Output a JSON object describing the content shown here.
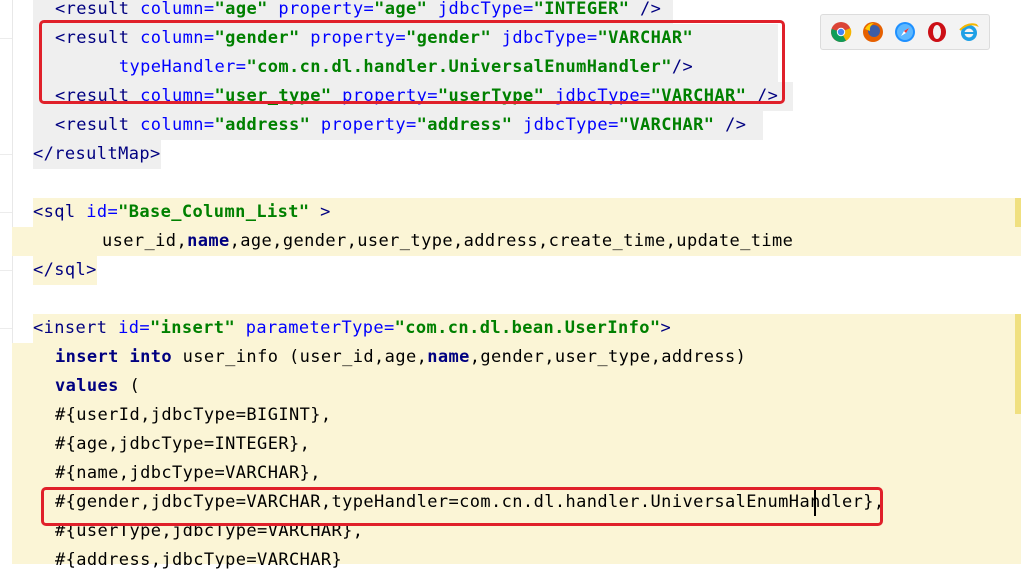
{
  "editor": {
    "lines": [
      {
        "id": "l1",
        "segments": [
          [
            "tag",
            "<result "
          ],
          [
            "attr",
            "column="
          ],
          [
            "str",
            "\"age\""
          ],
          [
            "plain",
            " "
          ],
          [
            "attr",
            "property="
          ],
          [
            "str",
            "\"age\""
          ],
          [
            "plain",
            " "
          ],
          [
            "attr",
            "jdbcType="
          ],
          [
            "str",
            "\"INTEGER\""
          ],
          [
            "plain",
            " "
          ],
          [
            "tag",
            "/>"
          ]
        ]
      },
      {
        "id": "l2",
        "segments": [
          [
            "tag",
            "<result "
          ],
          [
            "attr",
            "column="
          ],
          [
            "str",
            "\"gender\""
          ],
          [
            "plain",
            " "
          ],
          [
            "attr",
            "property="
          ],
          [
            "str",
            "\"gender\""
          ],
          [
            "plain",
            " "
          ],
          [
            "attr",
            "jdbcType="
          ],
          [
            "str",
            "\"VARCHAR\""
          ]
        ]
      },
      {
        "id": "l3",
        "segments": [
          [
            "plain",
            "      "
          ],
          [
            "attr",
            "typeHandler="
          ],
          [
            "str",
            "\"com.cn.dl.handler.UniversalEnumHandler\""
          ],
          [
            "tag",
            "/>"
          ]
        ]
      },
      {
        "id": "l4",
        "segments": [
          [
            "tag",
            "<result "
          ],
          [
            "attr",
            "column="
          ],
          [
            "str",
            "\"user_type\""
          ],
          [
            "plain",
            " "
          ],
          [
            "attr",
            "property="
          ],
          [
            "str",
            "\"userType\""
          ],
          [
            "plain",
            " "
          ],
          [
            "attr",
            "jdbcType="
          ],
          [
            "str",
            "\"VARCHAR\""
          ],
          [
            "plain",
            " "
          ],
          [
            "tag",
            "/>"
          ]
        ]
      },
      {
        "id": "l5",
        "segments": [
          [
            "tag",
            "<result "
          ],
          [
            "attr",
            "column="
          ],
          [
            "str",
            "\"address\""
          ],
          [
            "plain",
            " "
          ],
          [
            "attr",
            "property="
          ],
          [
            "str",
            "\"address\""
          ],
          [
            "plain",
            " "
          ],
          [
            "attr",
            "jdbcType="
          ],
          [
            "str",
            "\"VARCHAR\""
          ],
          [
            "plain",
            " "
          ],
          [
            "tag",
            "/>"
          ]
        ]
      },
      {
        "id": "l6",
        "segments": [
          [
            "tag",
            "</resultMap>"
          ]
        ]
      },
      {
        "id": "l7",
        "segments": []
      },
      {
        "id": "l8",
        "segments": [
          [
            "tag",
            "<sql "
          ],
          [
            "attr",
            "id="
          ],
          [
            "str",
            "\"Base_Column_List\""
          ],
          [
            "plain",
            " "
          ],
          [
            "tag",
            ">"
          ]
        ]
      },
      {
        "id": "l9",
        "segments": [
          [
            "plain",
            "user_id,"
          ],
          [
            "bold",
            "name"
          ],
          [
            "plain",
            ",age,gender,user_type,address,create_time,update_time"
          ]
        ]
      },
      {
        "id": "l10",
        "segments": [
          [
            "tag",
            "</sql>"
          ]
        ]
      },
      {
        "id": "l11",
        "segments": []
      },
      {
        "id": "l12",
        "segments": [
          [
            "tag",
            "<insert "
          ],
          [
            "attr",
            "id="
          ],
          [
            "str",
            "\"insert\""
          ],
          [
            "plain",
            " "
          ],
          [
            "attr",
            "parameterType="
          ],
          [
            "str",
            "\"com.cn.dl.bean.UserInfo\""
          ],
          [
            "tag",
            ">"
          ]
        ]
      },
      {
        "id": "l13",
        "segments": [
          [
            "kw",
            "insert into "
          ],
          [
            "plain",
            "user_info (user_id,age,"
          ],
          [
            "bold",
            "name"
          ],
          [
            "plain",
            ",gender,user_type,address)"
          ]
        ]
      },
      {
        "id": "l14",
        "segments": [
          [
            "kw",
            "values "
          ],
          [
            "plain",
            "("
          ]
        ]
      },
      {
        "id": "l15",
        "segments": [
          [
            "plain",
            "#{userId,jdbcType=BIGINT},"
          ]
        ]
      },
      {
        "id": "l16",
        "segments": [
          [
            "plain",
            "#{age,jdbcType=INTEGER},"
          ]
        ]
      },
      {
        "id": "l17",
        "segments": [
          [
            "plain",
            "#{name,jdbcType=VARCHAR},"
          ]
        ]
      },
      {
        "id": "l18",
        "segments": [
          [
            "plain",
            "#{gender,jdbcType=VARCHAR,typeHandler=com.cn.dl.handler.UniversalEnumHandler},"
          ]
        ]
      },
      {
        "id": "l19",
        "segments": [
          [
            "plain",
            "#{userType,jdbcType=VARCHAR},"
          ]
        ]
      },
      {
        "id": "l20",
        "segments": [
          [
            "plain",
            "#{address,jdbcType=VARCHAR}"
          ]
        ]
      }
    ]
  },
  "browser_icons": [
    "chrome-icon",
    "firefox-icon",
    "safari-icon",
    "opera-icon",
    "ie-icon"
  ],
  "colors": {
    "tag": "#000080",
    "attr": "#0000ff",
    "string": "#008000",
    "highlight": "#e0202a"
  }
}
